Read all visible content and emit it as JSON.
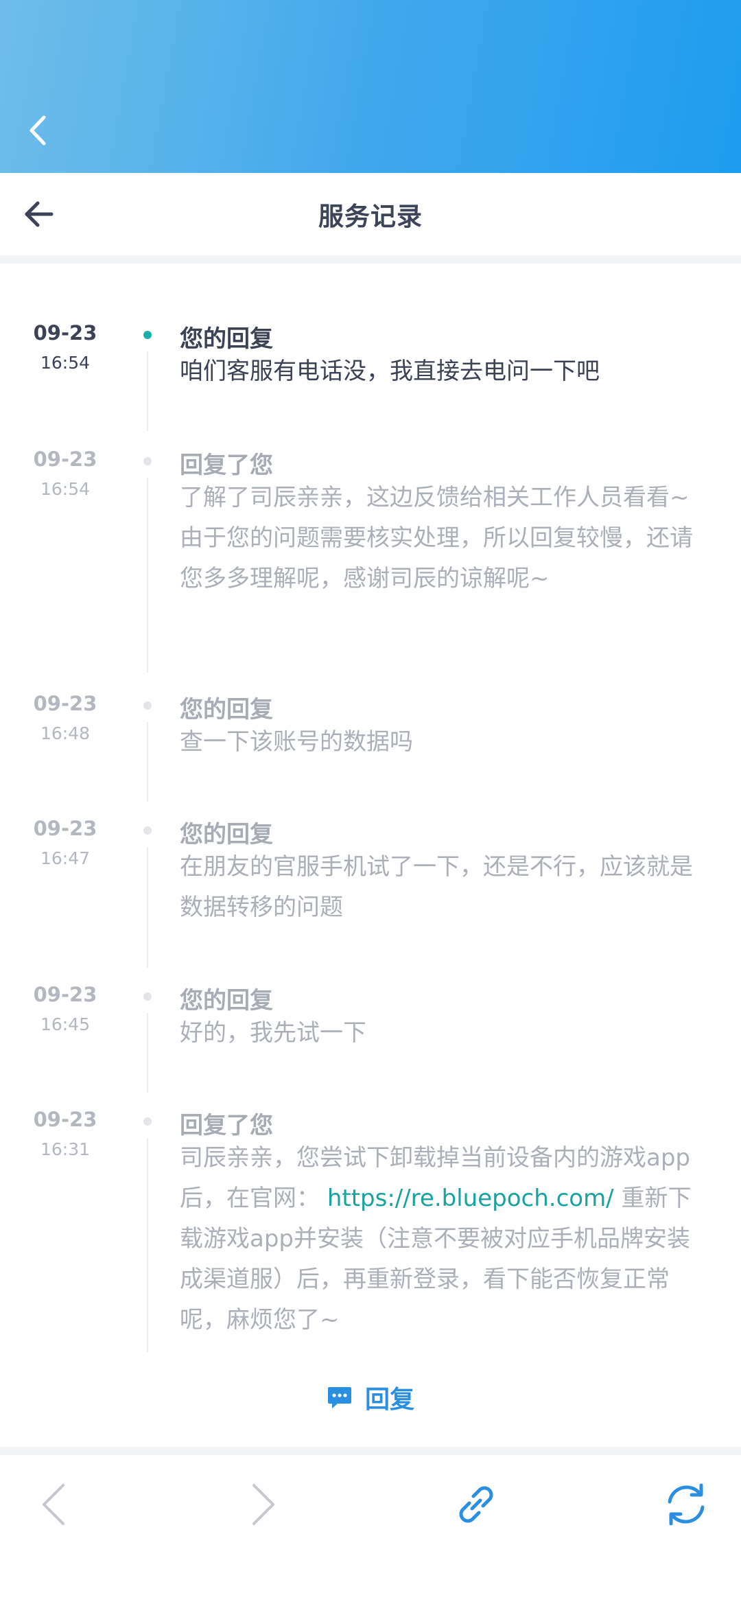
{
  "header": {
    "title": "服务记录"
  },
  "entries": [
    {
      "date": "09-23",
      "time": "16:54",
      "who": "您的回复",
      "message": "咱们客服有电话没，我直接去电问一下吧",
      "active": true
    },
    {
      "date": "09-23",
      "time": "16:54",
      "who": "回复了您",
      "message": "了解了司辰亲亲，这边反馈给相关工作人员看看~由于您的问题需要核实处理，所以回复较慢，还请您多多理解呢，感谢司辰的谅解呢~"
    },
    {
      "date": "09-23",
      "time": "16:48",
      "who": "您的回复",
      "message": "查一下该账号的数据吗"
    },
    {
      "date": "09-23",
      "time": "16:47",
      "who": "您的回复",
      "message": "在朋友的官服手机试了一下，还是不行，应该就是数据转移的问题"
    },
    {
      "date": "09-23",
      "time": "16:45",
      "who": "您的回复",
      "message": "好的，我先试一下"
    },
    {
      "date": "09-23",
      "time": "16:31",
      "who": "回复了您",
      "message_before": "司辰亲亲，您尝试下卸载掉当前设备内的游戏app后，在官网：",
      "message_link": "https://re.bluepoch.com/",
      "message_after": "重新下载游戏app并安装（注意不要被对应手机品牌安装成渠道服）后，再重新登录，看下能否恢复正常呢，麻烦您了~"
    }
  ],
  "reply_button": {
    "label": "回复",
    "icon": "chat-bubble-icon"
  },
  "toolbar": {
    "icons": [
      "back-chevron-icon",
      "forward-chevron-icon",
      "link-icon",
      "refresh-icon"
    ]
  },
  "colors": {
    "banner_start": "#6fbde9",
    "banner_end": "#1d9cef",
    "active_dot": "#1aafa8",
    "link": "#18a39e",
    "accent_blue": "#2a8fe0",
    "text_dark": "#3b4253",
    "text_muted": "#abafb8"
  }
}
